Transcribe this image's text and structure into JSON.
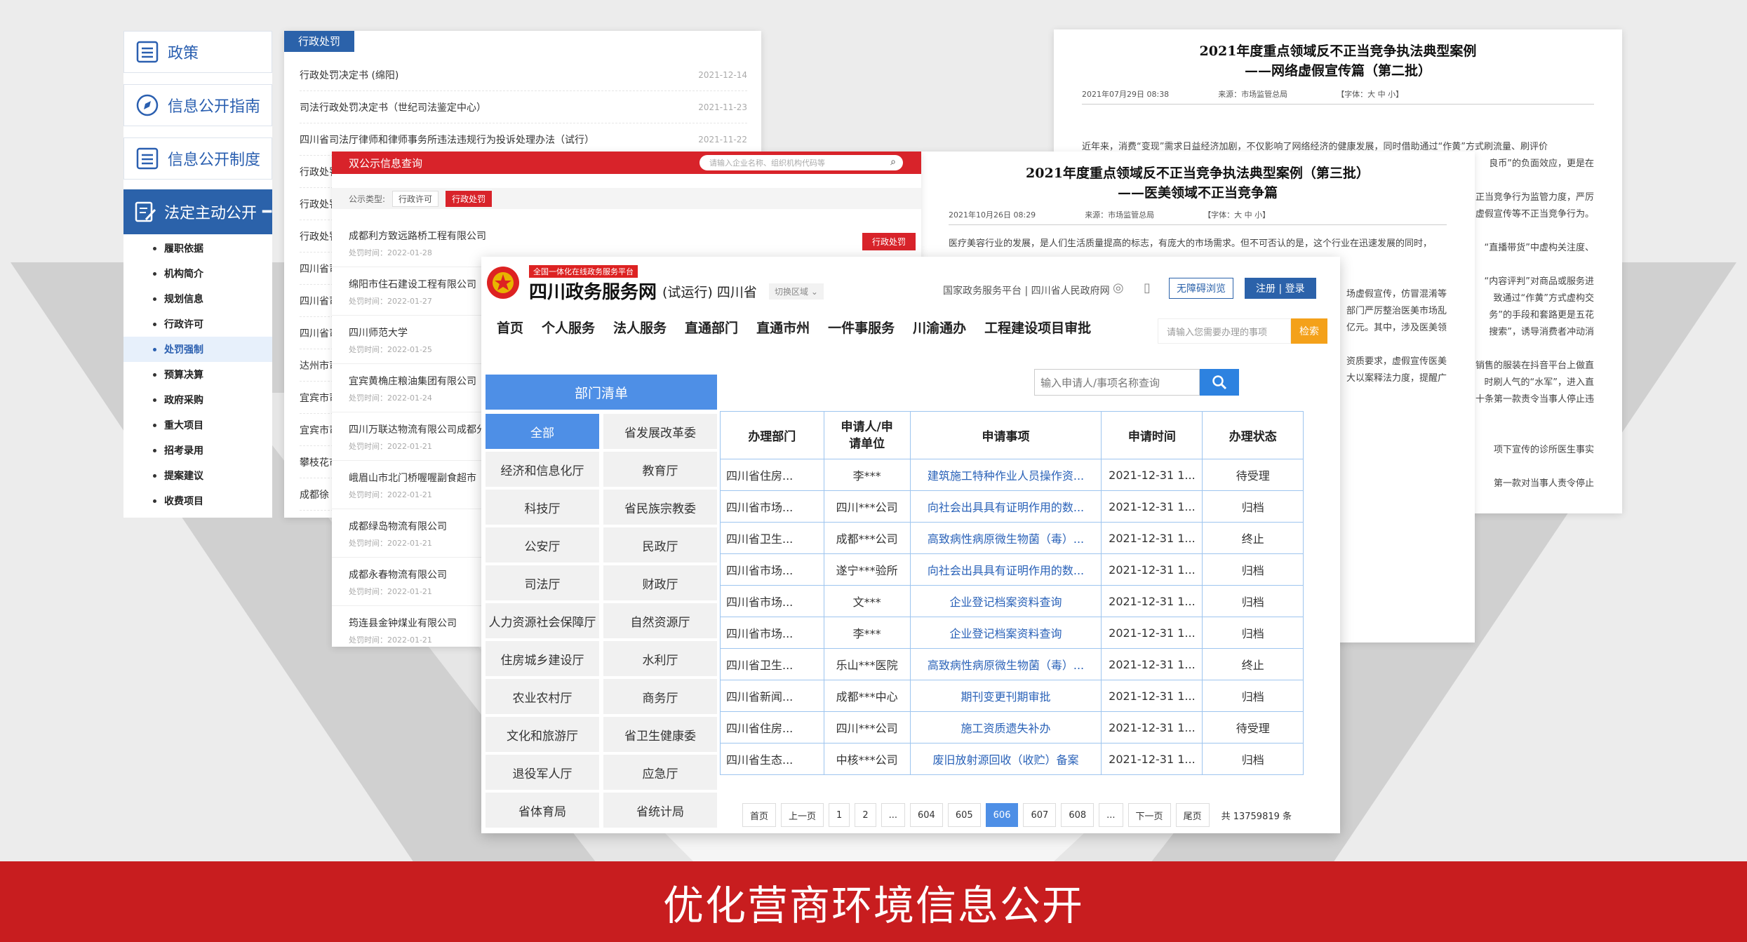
{
  "left_panel": {
    "buttons": [
      "政策",
      "信息公开指南",
      "信息公开制度"
    ],
    "active": "法定主动公开",
    "sub_items": [
      "履职依据",
      "机构简介",
      "规划信息",
      "行政许可",
      "处罚强制",
      "预算决算",
      "政府采购",
      "重大项目",
      "招考录用",
      "提案建议",
      "收费项目"
    ],
    "selected_sub": "处罚强制"
  },
  "admin_penalty": {
    "tab": "行政处罚",
    "rows": [
      {
        "title": "行政处罚决定书 (绵阳)",
        "date": "2021-12-14"
      },
      {
        "title": "司法行政处罚决定书（世纪司法鉴定中心）",
        "date": "2021-11-23"
      },
      {
        "title": "四川省司法厅律师和律师事务所违法违规行为投诉处理办法（试行）",
        "date": "2021-11-22"
      },
      {
        "title": "行政处罚",
        "date": ""
      },
      {
        "title": "行政处罚",
        "date": ""
      },
      {
        "title": "行政处罚",
        "date": ""
      },
      {
        "title": "四川省司",
        "date": ""
      },
      {
        "title": "四川省司",
        "date": ""
      },
      {
        "title": "四川省司",
        "date": ""
      },
      {
        "title": "达州市司",
        "date": ""
      },
      {
        "title": "宜宾市司",
        "date": ""
      },
      {
        "title": "宜宾市司",
        "date": ""
      },
      {
        "title": "攀枝花市",
        "date": ""
      },
      {
        "title": "成都徐",
        "date": ""
      }
    ]
  },
  "dual_publicity": {
    "title": "双公示信息查询",
    "search_placeholder": "请输入企业名称、组织机构代码等",
    "category_label": "公示类型:",
    "chips": [
      "行政许可",
      "行政处罚"
    ],
    "badge": "行政处罚",
    "items": [
      {
        "name": "成都利方致远路桥工程有限公司",
        "time": "处罚时间：2022-01-28"
      },
      {
        "name": "绵阳市住石建设工程有限公司",
        "time": "处罚时间：2022-01-27"
      },
      {
        "name": "四川师范大学",
        "time": "处罚时间：2022-01-25"
      },
      {
        "name": "宜宾黄桷庄粮油集团有限公司",
        "time": "处罚时间：2022-01-24"
      },
      {
        "name": "四川万联达物流有限公司成都分公司",
        "time": "处罚时间：2022-01-21"
      },
      {
        "name": "峨眉山市北门桥喔喔副食超市",
        "time": "处罚时间：2022-01-21"
      },
      {
        "name": "成都绿岛物流有限公司",
        "time": "处罚时间：2022-01-21"
      },
      {
        "name": "成都永春物流有限公司",
        "time": "处罚时间：2022-01-21"
      },
      {
        "name": "筠连县金钟煤业有限公司",
        "time": "处罚时间：2022-01-21"
      }
    ]
  },
  "article2": {
    "title1": "2021年度重点领域反不正当竞争执法典型案例",
    "title2": "——网络虚假宣传篇（第二批）",
    "date": "2021年07月29日 08:38",
    "source": "来源：市场监管总局",
    "font": "【字体：大 中 小】",
    "text": [
      "近年来，消费“变现”需求日益经济加剧，不仅影响了网络经济的健康发展，同时借助通过“作黄”方式刷流量、刷评价",
      "良币”的负面效应，更是在",
      "正当竞争行为监管力度，严厉",
      "虚假宣传等不正当竞争行为。",
      "“直播带货”中虚构关注度、",
      "“内容评判”对商品或服务进",
      "致通过“作黄”方式虚构交",
      "务”的手段和套路更是五花",
      "搜索”，诱导消费者冲动消",
      "销售的服装在抖音平台上做直",
      "时刷人气的“水军”，进入直",
      "十条第一款责令当事人停止违",
      "项下宣传的诊所医生事实",
      "第一款对当事人责令停止"
    ]
  },
  "article3": {
    "title1": "2021年度重点领域反不正当竞争执法典型案例（第三批）",
    "title2": "——医美领域不正当竞争篇",
    "date": "2021年10月26日 08:29",
    "source": "来源：市场监管总局",
    "font": "【字体：大 中 小】",
    "text": [
      "医疗美容行业的发展，是人们生活质量提高的标志，有庞大的市场需求。但不可否认的是，这个行业在迅速发展的同时，",
      "场虚假宣传，仿冒混淆等",
      "部门严厉整治医美市场乱",
      "亿元。其中，涉及医美领",
      "资质要求，虚假宣传医美",
      "大以案释法力度，提醒广"
    ]
  },
  "portal": {
    "badge": "全国一体化在线政务服务平台",
    "site_name": "四川政务服务网",
    "site_suffix": "(试运行) 四川省",
    "switch_region": "切换区域",
    "top_links": "国家政务服务平台 | 四川省人民政府网",
    "accessible": "无障碍浏览",
    "login": "注册 | 登录",
    "nav": [
      "首页",
      "个人服务",
      "法人服务",
      "直通部门",
      "直通市州",
      "一件事服务",
      "川渝通办",
      "工程建设项目审批"
    ],
    "search_placeholder": "请输入您需要办理的事项",
    "search_btn": "检索",
    "query_placeholder": "输入申请人/事项名称查询",
    "dept_header": "部门清单",
    "depts": [
      "全部",
      "省发展改革委",
      "经济和信息化厅",
      "教育厅",
      "科技厅",
      "省民族宗教委",
      "公安厅",
      "民政厅",
      "司法厅",
      "财政厅",
      "人力资源社会保障厅",
      "自然资源厅",
      "住房城乡建设厅",
      "水利厅",
      "农业农村厅",
      "商务厅",
      "文化和旅游厅",
      "省卫生健康委",
      "退役军人厅",
      "应急厅",
      "省体育局",
      "省统计局"
    ],
    "table_headers": [
      "办理部门",
      "申请人/申请单位",
      "申请事项",
      "申请时间",
      "办理状态"
    ],
    "rows": [
      [
        "四川省住房...",
        "李***",
        "建筑施工特种作业人员操作资...",
        "2021-12-31 1...",
        "待受理"
      ],
      [
        "四川省市场...",
        "四川***公司",
        "向社会出具具有证明作用的数...",
        "2021-12-31 1...",
        "归档"
      ],
      [
        "四川省卫生...",
        "成都***公司",
        "高致病性病原微生物菌（毒）...",
        "2021-12-31 1...",
        "终止"
      ],
      [
        "四川省市场...",
        "遂宁***验所",
        "向社会出具具有证明作用的数...",
        "2021-12-31 1...",
        "归档"
      ],
      [
        "四川省市场...",
        "文***",
        "企业登记档案资料查询",
        "2021-12-31 1...",
        "归档"
      ],
      [
        "四川省市场...",
        "李***",
        "企业登记档案资料查询",
        "2021-12-31 1...",
        "归档"
      ],
      [
        "四川省卫生...",
        "乐山***医院",
        "高致病性病原微生物菌（毒）...",
        "2021-12-31 1...",
        "终止"
      ],
      [
        "四川省新闻...",
        "成都***中心",
        "期刊变更刊期审批",
        "2021-12-31 1...",
        "归档"
      ],
      [
        "四川省住房...",
        "四川***公司",
        "施工资质遗失补办",
        "2021-12-31 1...",
        "待受理"
      ],
      [
        "四川省生态...",
        "中核***公司",
        "废旧放射源回收（收贮）备案",
        "2021-12-31 1...",
        "归档"
      ]
    ],
    "pagination": [
      "首页",
      "上一页",
      "1",
      "2",
      "...",
      "604",
      "605",
      "606",
      "607",
      "608",
      "...",
      "下一页",
      "尾页"
    ],
    "current_page": "606",
    "total": "共 13759819 条"
  },
  "footer": "优化营商环境信息公开"
}
